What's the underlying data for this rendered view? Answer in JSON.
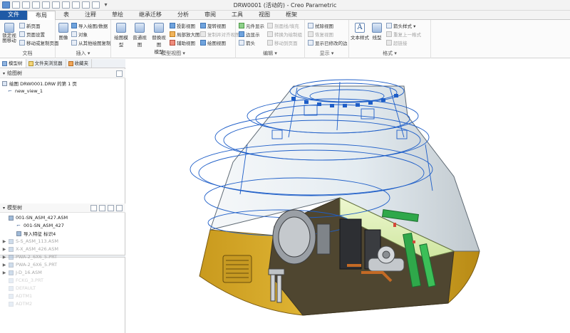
{
  "window": {
    "title": "DRW0001 (活动的) - Creo Parametric",
    "qat_dropdown": "▾"
  },
  "tabs": [
    "文件",
    "布局",
    "表",
    "注释",
    "草绘",
    "继承迁移",
    "分析",
    "审阅",
    "工具",
    "视图",
    "框架"
  ],
  "ribbon": {
    "document": {
      "label": "文档",
      "big_button": "锁定视图移动",
      "buttons": [
        "新页面",
        "页面设置",
        "移动或复制页面"
      ]
    },
    "insert": {
      "label": "插入 ▾",
      "big_button": "图像",
      "buttons": [
        "导入绘图/数据",
        "对象",
        "从其他绘图复制"
      ]
    },
    "model_views": {
      "label": "模型视图 ▾",
      "big_buttons": [
        "绘图模型",
        "普通视图",
        "替换视图",
        "模型"
      ],
      "buttons": [
        "投影视图",
        "局部放大图",
        "辅助视图",
        "旋转视图",
        "复制并对齐视图",
        "绘图视图"
      ]
    },
    "edit": {
      "label": "编辑 ▾",
      "buttons": [
        "元件显示",
        "边显示",
        "箭头",
        "剖面线/填充",
        "转换为绘制组",
        "移动到页面"
      ]
    },
    "display": {
      "label": "显示 ▾",
      "buttons": [
        "拭除视图",
        "恢复视图",
        "显示已修改的边"
      ]
    },
    "format": {
      "label": "格式 ▾",
      "big_buttons": [
        "文本样式",
        "线型"
      ],
      "buttons": [
        "箭头样式 ▾",
        "重复上一格式",
        "超链接"
      ]
    }
  },
  "left_panel": {
    "tabs": [
      "模型树",
      "文件夹浏览器",
      "收藏夹"
    ],
    "drawing_tree": {
      "header": "绘图树",
      "items": [
        "绘图 DRW0001.DRW 的第 1 页",
        "new_view_1"
      ]
    },
    "model_tree": {
      "header": "模型树",
      "items": [
        {
          "label": "001-SN_ASM_427.ASM",
          "state": "normal",
          "expand": ""
        },
        {
          "label": "001-SN_ASM_427",
          "state": "normal",
          "expand": ""
        },
        {
          "label": "导入特征 标识4",
          "state": "normal",
          "expand": ""
        },
        {
          "label": "S-S_ASM_113.ASM",
          "state": "faded",
          "expand": "▶"
        },
        {
          "label": "X-X_ASM_426.ASM",
          "state": "faded",
          "expand": "▶"
        },
        {
          "label": "PWA-2_6X6_5.PRT",
          "state": "faded",
          "expand": "▶"
        },
        {
          "label": "PWA-2_6X6_5.PRT",
          "state": "faded",
          "expand": "▶"
        },
        {
          "label": "J-D_16.ASM",
          "state": "faded",
          "expand": "▶"
        },
        {
          "label": "FCKG_3.PRT",
          "state": "superfaded",
          "expand": ""
        },
        {
          "label": "DEFAULT",
          "state": "superfaded",
          "expand": ""
        },
        {
          "label": "ADTM1",
          "state": "superfaded",
          "expand": ""
        },
        {
          "label": "ADTM2",
          "state": "superfaded",
          "expand": ""
        }
      ]
    }
  },
  "colors": {
    "file_tab": "#1f5aa6",
    "capsule_gold": "#d4a72c",
    "glass_tint": "#dff0b8",
    "wire_blue": "#1e5ec8",
    "pcb_green": "#2fa84a"
  }
}
